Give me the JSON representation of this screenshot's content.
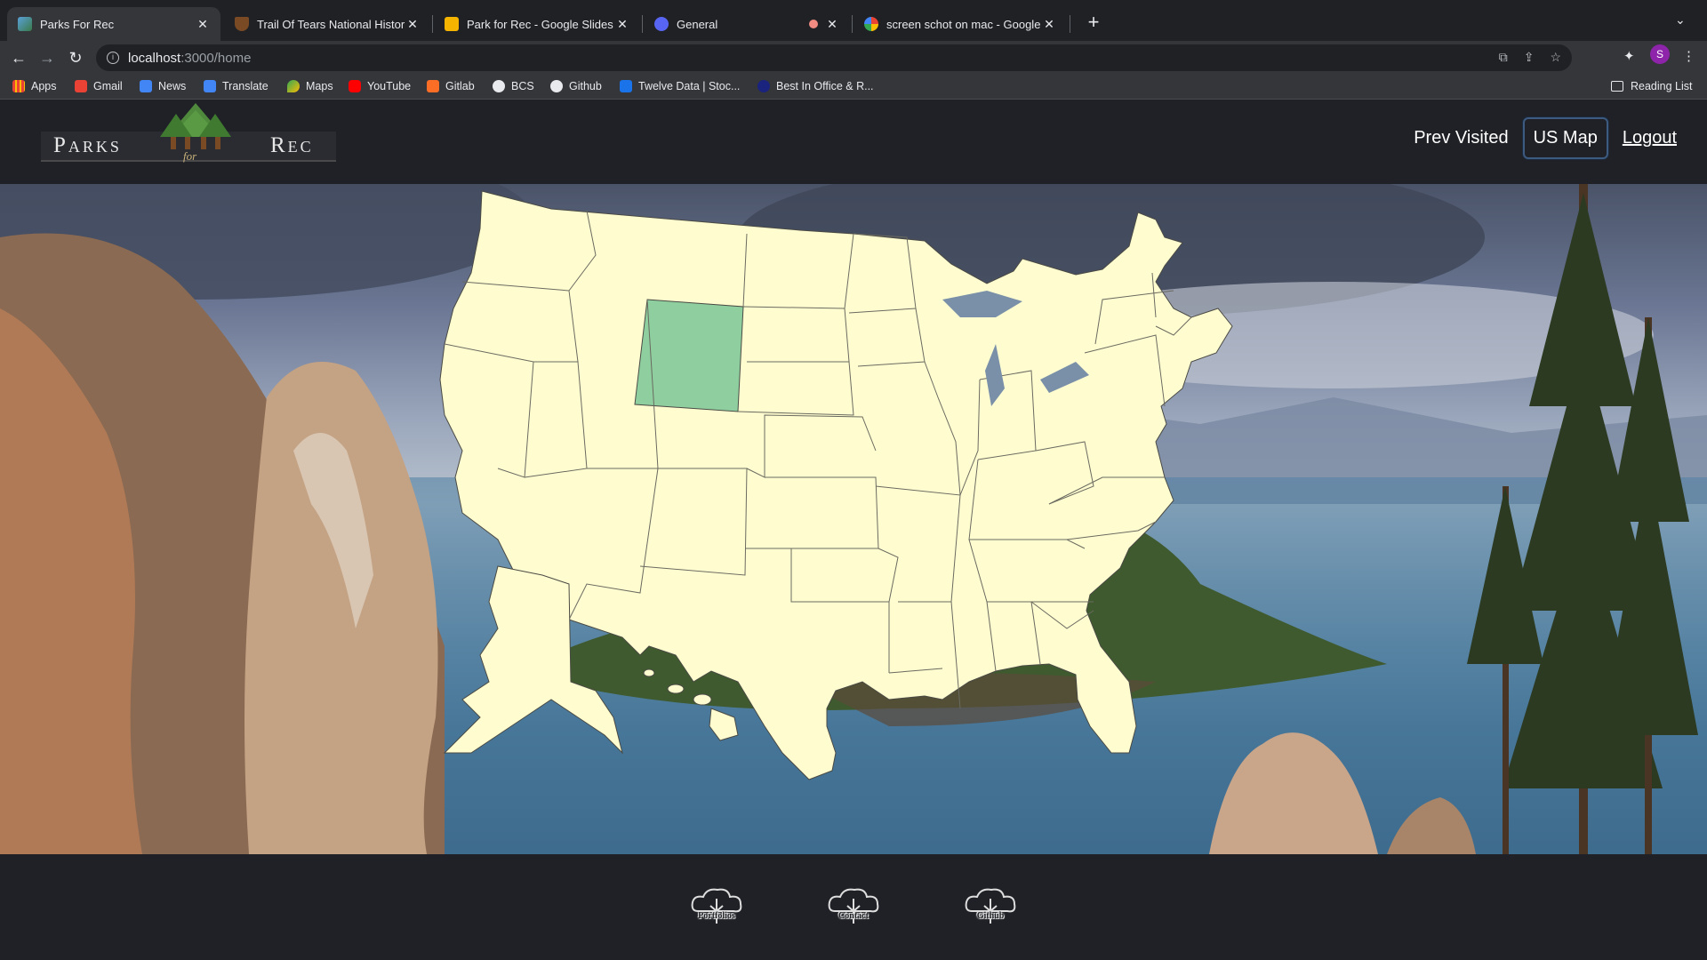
{
  "browser": {
    "tabs": [
      {
        "title": "Parks For Rec",
        "active": true
      },
      {
        "title": "Trail Of Tears National Historic",
        "active": false
      },
      {
        "title": "Park for Rec - Google Slides",
        "active": false
      },
      {
        "title": "General",
        "active": false
      },
      {
        "title": "screen schot on mac - Google",
        "active": false
      }
    ],
    "url_host": "localhost",
    "url_path": ":3000/home",
    "profile_initial": "S",
    "bookmarks": [
      "Apps",
      "Gmail",
      "News",
      "Translate",
      "Maps",
      "YouTube",
      "Gitlab",
      "BCS",
      "Github",
      "Twelve Data | Stoc...",
      "Best In Office & R..."
    ],
    "reading_list": "Reading List"
  },
  "site": {
    "logo": {
      "left_word": "Parks",
      "middle_word": "for",
      "right_word": "Rec"
    },
    "nav": {
      "prev_visited": "Prev Visited",
      "us_map": "US Map",
      "logout": "Logout"
    },
    "map": {
      "highlighted_state": "Wyoming",
      "fill": "#fffdd0",
      "highlight_fill": "#8fcf9f"
    },
    "footer": {
      "links": [
        "Portfolios",
        "Contact",
        "Github"
      ]
    }
  }
}
